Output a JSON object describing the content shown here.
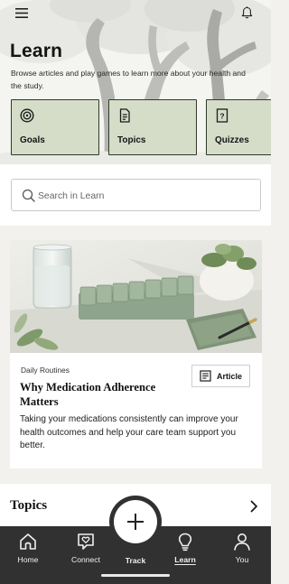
{
  "header": {
    "menu_icon": "menu-icon",
    "bell_icon": "bell-icon",
    "title": "Learn",
    "intro": "Browse articles and play games to learn more about your health and the study."
  },
  "categories": [
    {
      "label": "Goals",
      "icon": "target-icon"
    },
    {
      "label": "Topics",
      "icon": "document-icon"
    },
    {
      "label": "Quizzes",
      "icon": "quiz-icon"
    }
  ],
  "search": {
    "placeholder": "Search in Learn",
    "icon": "search-icon"
  },
  "featured": {
    "category": "Daily Routines",
    "title": "Why Medication Adherence Matters",
    "description": "Taking your medications consistently can improve your health outcomes and help your care team support you better.",
    "badge_label": "Article",
    "badge_icon": "article-icon",
    "image": "pill-organizer-photo"
  },
  "topics_section": {
    "title": "Topics",
    "icon": "chevron-right-icon"
  },
  "nav": {
    "items": [
      {
        "label": "Home",
        "icon": "home-icon"
      },
      {
        "label": "Connect",
        "icon": "heart-chat-icon"
      },
      {
        "label": "Track",
        "icon": "plus-icon"
      },
      {
        "label": "Learn",
        "icon": "lightbulb-icon"
      },
      {
        "label": "You",
        "icon": "person-icon"
      }
    ],
    "active": "Learn"
  },
  "colors": {
    "card_green": "#d5ddc8",
    "nav_dark": "#313131",
    "page_bg": "#f2f1ee"
  }
}
